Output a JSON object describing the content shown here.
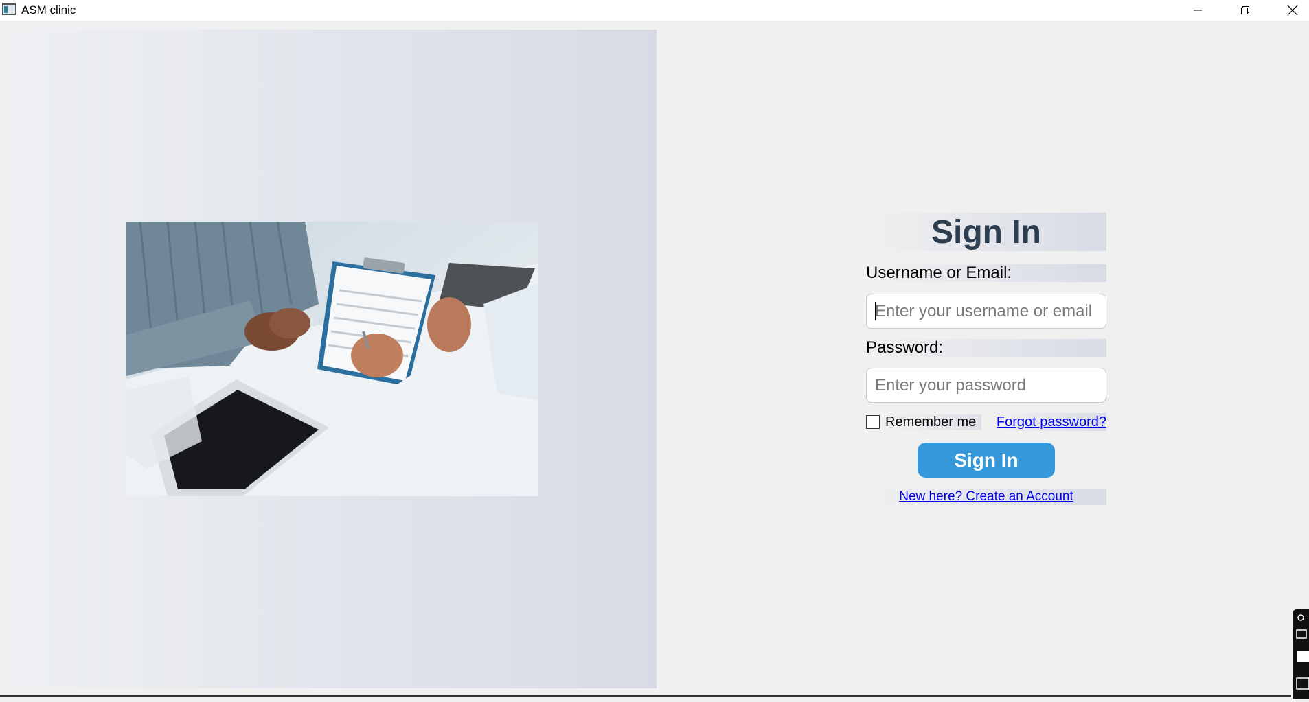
{
  "window": {
    "title": "ASM clinic",
    "controls": {
      "minimize": "minimize-icon",
      "maximize": "restore-icon",
      "close": "close-icon"
    }
  },
  "hero": {
    "image": "doctor-patient-consultation-photo"
  },
  "form": {
    "title": "Sign In",
    "username_label": "Username or Email:",
    "username_placeholder": "Enter your username or email",
    "username_value": "",
    "password_label": "Password:",
    "password_placeholder": "Enter your password",
    "password_value": "",
    "remember_label": "Remember me",
    "remember_checked": false,
    "forgot_link": "Forgot password?",
    "submit_label": "Sign In",
    "create_account_link": "New here? Create an Account"
  },
  "colors": {
    "title": "#2c3e50",
    "button": "#3498db",
    "link": "#0000ee"
  }
}
